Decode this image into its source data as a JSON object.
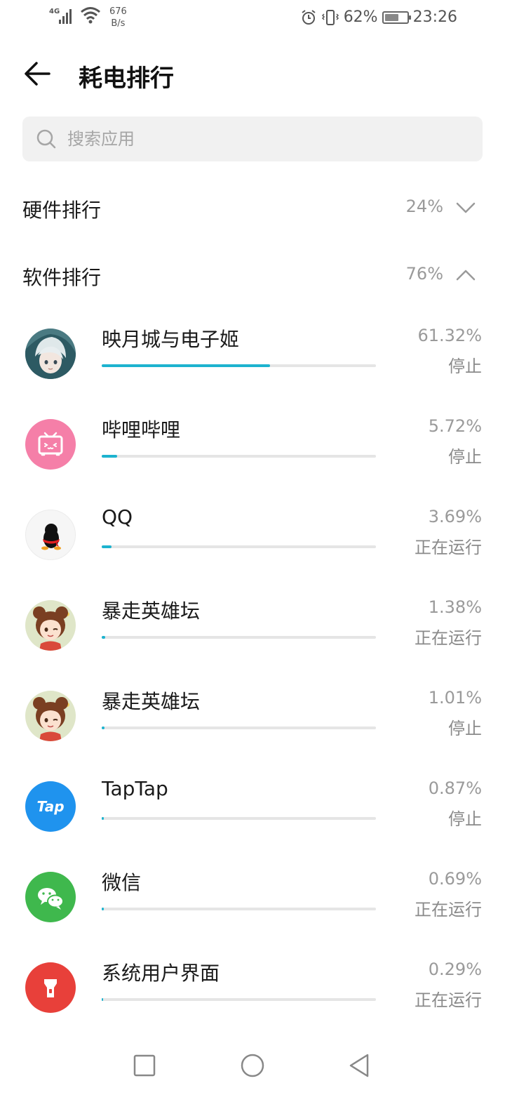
{
  "status_bar": {
    "network": "4G",
    "speed_value": "676",
    "speed_unit": "B/s",
    "battery_percent": "62%",
    "battery_level": 0.62,
    "time": "23:26"
  },
  "header": {
    "title": "耗电排行"
  },
  "search": {
    "placeholder": "搜索应用"
  },
  "sections": {
    "hardware": {
      "label": "硬件排行",
      "percent": "24%"
    },
    "software": {
      "label": "软件排行",
      "percent": "76%"
    }
  },
  "apps": [
    {
      "name": "映月城与电子姬",
      "percent": "61.32%",
      "status": "停止",
      "usage": 0.6132,
      "icon": "anime-girl-avatar-icon"
    },
    {
      "name": "哔哩哔哩",
      "percent": "5.72%",
      "status": "停止",
      "usage": 0.0572,
      "icon": "bilibili-tv-icon"
    },
    {
      "name": "QQ",
      "percent": "3.69%",
      "status": "正在运行",
      "usage": 0.0369,
      "icon": "qq-penguin-icon"
    },
    {
      "name": "暴走英雄坛",
      "percent": "1.38%",
      "status": "正在运行",
      "usage": 0.0138,
      "icon": "cartoon-girl-avatar-icon"
    },
    {
      "name": "暴走英雄坛",
      "percent": "1.01%",
      "status": "停止",
      "usage": 0.0101,
      "icon": "cartoon-girl-avatar-icon"
    },
    {
      "name": "TapTap",
      "percent": "0.87%",
      "status": "停止",
      "usage": 0.0087,
      "icon": "taptap-icon",
      "icon_text": "Tap"
    },
    {
      "name": "微信",
      "percent": "0.69%",
      "status": "正在运行",
      "usage": 0.0069,
      "icon": "wechat-icon"
    },
    {
      "name": "系统用户界面",
      "percent": "0.29%",
      "status": "正在运行",
      "usage": 0.0029,
      "icon": "flashlight-icon"
    }
  ],
  "colors": {
    "accent": "#1db3cf",
    "bilibili": "#f57fa8",
    "taptap": "#1f93ee",
    "wechat": "#3fb84d",
    "system_ui": "#e8403a"
  }
}
